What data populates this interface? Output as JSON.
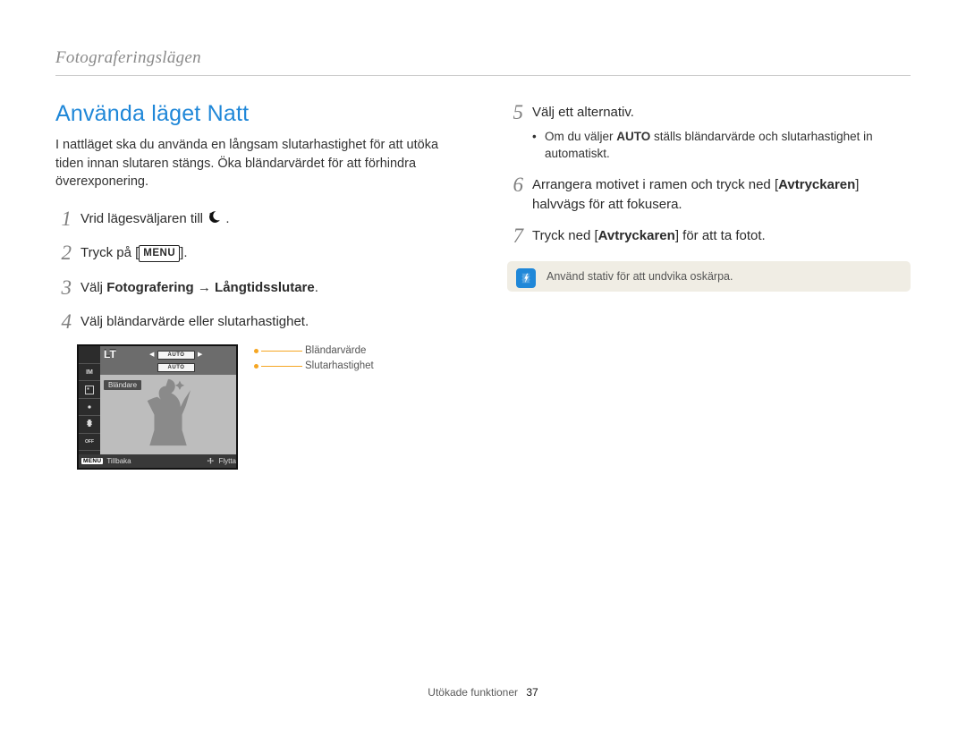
{
  "running_head": "Fotograferingslägen",
  "section_title": "Använda läget Natt",
  "intro": "I nattläget ska du använda en långsam slutarhastighet för att utöka tiden innan slutaren stängs. Öka bländarvärdet för att förhindra överexponering.",
  "steps_left": {
    "s1_a": "Vrid lägesväljaren till ",
    "s1_b": ".",
    "s2_a": "Tryck på [",
    "s2_menu": "MENU",
    "s2_b": "].",
    "s3_a": "Välj ",
    "s3_b_bold": "Fotografering",
    "s3_arrow": " → ",
    "s3_c_bold": "Långtidsslutare",
    "s3_d": ".",
    "s4": "Välj bländarvärde eller slutarhastighet."
  },
  "steps_right": {
    "s5": "Välj ett alternativ.",
    "s5_sub_a": "Om du väljer ",
    "s5_sub_bold": "AUTO",
    "s5_sub_b": " ställs bländarvärde och slutarhastighet in automatiskt.",
    "s6_a": "Arrangera motivet i ramen och tryck ned [",
    "s6_bold": "Avtryckaren",
    "s6_b": "] halvvägs för att fokusera.",
    "s7_a": "Tryck ned [",
    "s7_bold": "Avtryckaren",
    "s7_b": "] för att ta fotot."
  },
  "note_text": "Använd stativ för att undvika oskärpa.",
  "screen": {
    "lt": "LT",
    "auto1": "AUTO",
    "auto2": "AUTO",
    "blandare": "Bländare",
    "bot_back": "Tillbaka",
    "bot_move": "Flytta",
    "menu_key": "MENU",
    "side_im": "IM",
    "side_off": "OFF"
  },
  "callouts": {
    "aperture": "Bländarvärde",
    "shutter": "Slutarhastighet"
  },
  "footer_label": "Utökade funktioner",
  "footer_page": "37"
}
